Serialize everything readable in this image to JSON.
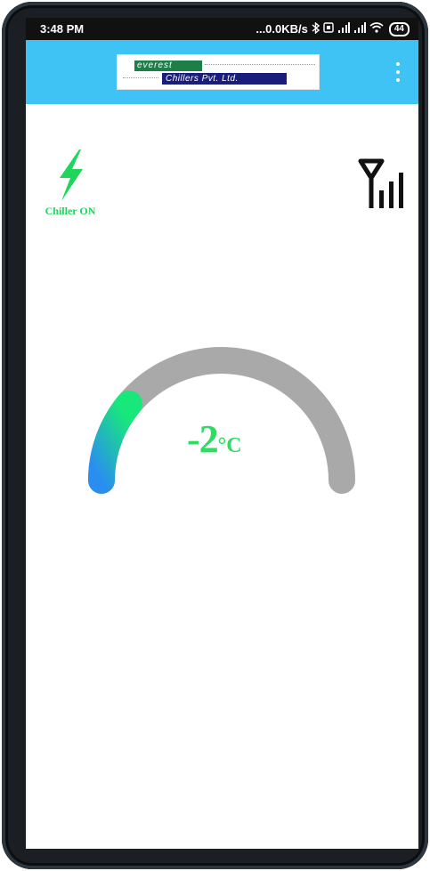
{
  "status_bar": {
    "time": "3:48 PM",
    "network_speed": "...0.0KB/s",
    "battery": "44",
    "icons": [
      "bluetooth-icon",
      "vibrate-icon",
      "cell-signal-icon",
      "cell-signal-icon",
      "wifi-icon"
    ]
  },
  "app_bar": {
    "logo_line1": "everest",
    "logo_line2": "Chillers Pvt. Ltd.",
    "color": "#3fc3f4",
    "menu_icon": "more-vert-icon"
  },
  "power": {
    "icon": "lightning-bolt-icon",
    "label": "Chiller ON",
    "color": "#1dd65a"
  },
  "signal": {
    "icon": "signal-antenna-icon"
  },
  "gauge": {
    "value": "-2",
    "unit": "°C",
    "fill_fraction": 0.22,
    "track_color": "#a9a9a9",
    "gradient_start": "#2a8ef0",
    "gradient_end": "#18e87a",
    "value_color": "#2edc62"
  }
}
